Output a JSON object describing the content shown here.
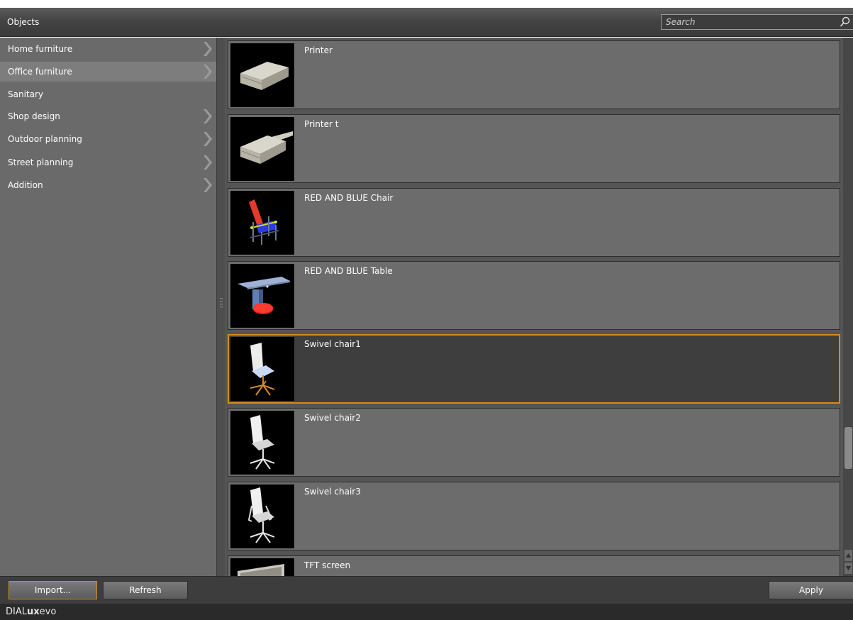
{
  "header": {
    "title": "Objects",
    "search_placeholder": "Search"
  },
  "sidebar": {
    "items": [
      {
        "label": "Home furniture",
        "has_children": true,
        "selected": false
      },
      {
        "label": "Office furniture",
        "has_children": true,
        "selected": true
      },
      {
        "label": "Sanitary",
        "has_children": false,
        "selected": false
      },
      {
        "label": "Shop design",
        "has_children": true,
        "selected": false
      },
      {
        "label": "Outdoor planning",
        "has_children": true,
        "selected": false
      },
      {
        "label": "Street planning",
        "has_children": true,
        "selected": false
      },
      {
        "label": "Addition",
        "has_children": true,
        "selected": false
      }
    ]
  },
  "objects": [
    {
      "label": "Printer",
      "thumbnail": "printer-icon",
      "selected": false
    },
    {
      "label": "Printer t",
      "thumbnail": "printer-icon",
      "selected": false
    },
    {
      "label": "RED AND BLUE Chair",
      "thumbnail": "red-blue-chair-icon",
      "selected": false
    },
    {
      "label": "RED AND BLUE Table",
      "thumbnail": "red-blue-table-icon",
      "selected": false
    },
    {
      "label": "Swivel chair1",
      "thumbnail": "swivel-chair-icon",
      "selected": true
    },
    {
      "label": "Swivel chair2",
      "thumbnail": "swivel-chair-icon",
      "selected": false
    },
    {
      "label": "Swivel chair3",
      "thumbnail": "swivel-chair-icon",
      "selected": false
    },
    {
      "label": "TFT screen",
      "thumbnail": "tft-screen-icon",
      "selected": false
    }
  ],
  "footer": {
    "import_label": "Import...",
    "refresh_label": "Refresh",
    "apply_label": "Apply"
  },
  "statusbar": {
    "brand_prefix": "DIAL",
    "brand_bold": "ux",
    "brand_suffix": "evo"
  },
  "colors": {
    "accent": "#d88a1e",
    "panel": "#6a6a6a",
    "selected_card": "#3e3e3e"
  }
}
